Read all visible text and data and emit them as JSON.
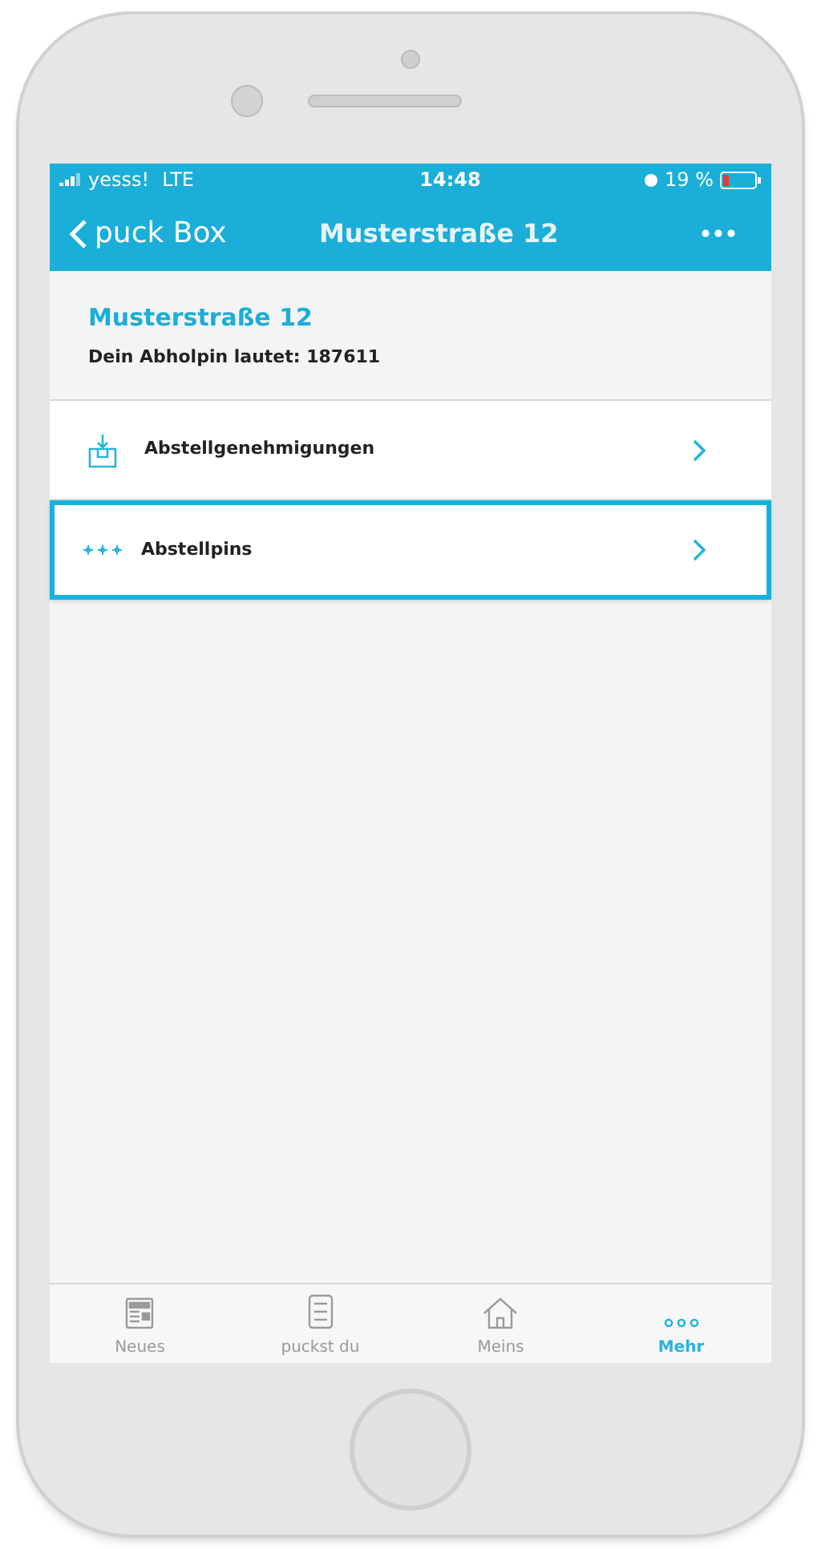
{
  "status_bar": {
    "carrier": "yesss!",
    "network": "LTE",
    "time": "14:48",
    "battery": "19 %"
  },
  "nav_bar": {
    "back_label": "puck Box",
    "title": "Musterstraße 12"
  },
  "header": {
    "title": "Musterstraße 12",
    "subtitle": "Dein Abholpin lautet: 187611"
  },
  "rows": [
    {
      "kind": "download",
      "label": "Abstellgenehmigungen",
      "highlighted": false
    },
    {
      "kind": "pins",
      "label": "Abstellpins",
      "highlighted": true
    }
  ],
  "tab_bar": [
    {
      "kind": "news",
      "label": "Neues",
      "selected": false
    },
    {
      "kind": "list",
      "label": "puckst du",
      "selected": false
    },
    {
      "kind": "home",
      "label": "Meins",
      "selected": false
    },
    {
      "kind": "more",
      "label": "Mehr",
      "selected": true
    }
  ]
}
